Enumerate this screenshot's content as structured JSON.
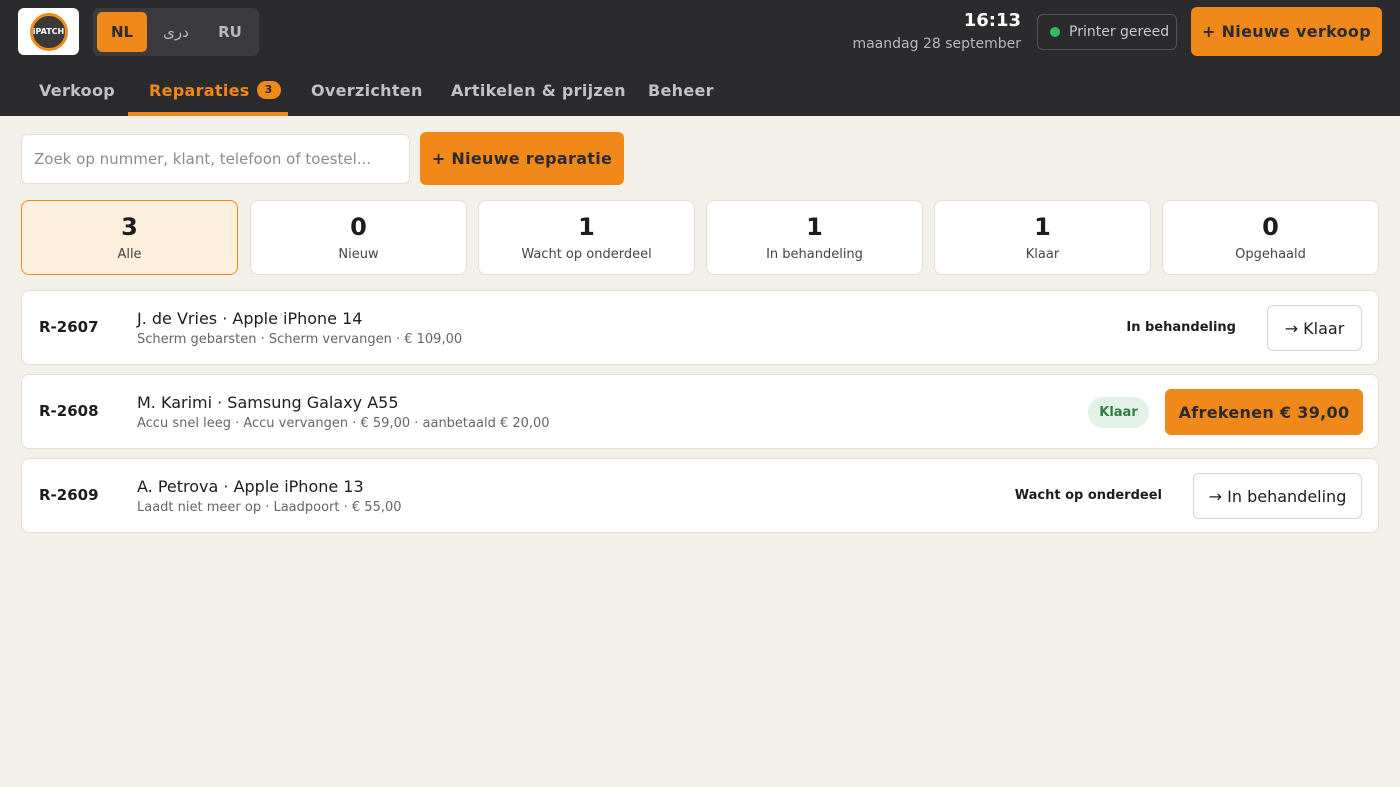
{
  "header": {
    "logo_text": "iPATCH",
    "languages": [
      {
        "label": "NL",
        "active": true
      },
      {
        "label": "دری",
        "active": false
      },
      {
        "label": "RU",
        "active": false
      }
    ],
    "time": "16:13",
    "date": "maandag 28 september",
    "printer_status": "Printer gereed",
    "new_sale_label": "+ Nieuwe verkoop"
  },
  "nav": {
    "tabs": [
      {
        "label": "Verkoop"
      },
      {
        "label": "Reparaties",
        "badge": "3",
        "active": true
      },
      {
        "label": "Overzichten"
      },
      {
        "label": "Artikelen & prijzen"
      },
      {
        "label": "Beheer"
      }
    ]
  },
  "search": {
    "placeholder": "Zoek op nummer, klant, telefoon of toestel...",
    "value": ""
  },
  "new_repair_label": "+ Nieuwe reparatie",
  "stats": [
    {
      "count": "3",
      "label": "Alle",
      "active": true
    },
    {
      "count": "0",
      "label": "Nieuw"
    },
    {
      "count": "1",
      "label": "Wacht op onderdeel"
    },
    {
      "count": "1",
      "label": "In behandeling"
    },
    {
      "count": "1",
      "label": "Klaar"
    },
    {
      "count": "0",
      "label": "Opgehaald"
    }
  ],
  "repairs": [
    {
      "id": "R-2607",
      "title": "J. de Vries · Apple iPhone 14",
      "details": "Scherm gebarsten · Scherm vervangen · € 109,00",
      "status": "In behandeling",
      "action": "→ Klaar"
    },
    {
      "id": "R-2608",
      "title": "M. Karimi · Samsung Galaxy A55",
      "details": "Accu snel leeg · Accu vervangen · € 59,00 · aanbetaald € 20,00",
      "status": "Klaar",
      "action": "Afrekenen € 39,00"
    },
    {
      "id": "R-2609",
      "title": "A. Petrova · Apple iPhone 13",
      "details": "Laadt niet meer op · Laadpoort · € 55,00",
      "status": "Wacht op onderdeel",
      "action": "→ In behandeling"
    }
  ],
  "colors": {
    "accent": "#f0891a",
    "topbar": "#2b2b2e",
    "background": "#f3f0ea",
    "ready_pill_bg": "#e4f1e6",
    "ready_pill_text": "#2e7d41",
    "printer_ok": "#2fbf62"
  }
}
